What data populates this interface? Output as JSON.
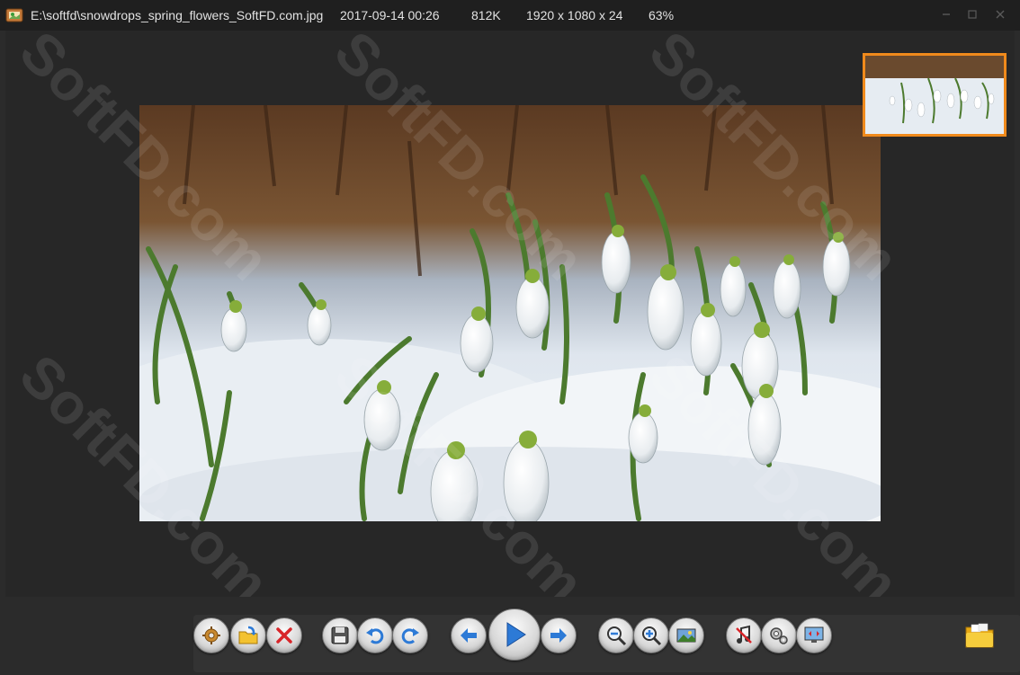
{
  "title_bar": {
    "file_path": "E:\\softfd\\snowdrops_spring_flowers_SoftFD.com.jpg",
    "date": "2017-09-14 00:26",
    "file_size": "812K",
    "dimensions": "1920 x 1080 x 24",
    "zoom": "63%",
    "controls": [
      "minimize-icon",
      "maximize-icon",
      "close-icon"
    ]
  },
  "watermark": {
    "text": "SoftFD.com"
  },
  "toolbar": {
    "buttons": [
      "settings-icon",
      "open-folder-icon",
      "delete-icon",
      "save-icon",
      "rotate-left-icon",
      "rotate-right-icon",
      "previous-icon",
      "play-slideshow-icon",
      "next-icon",
      "zoom-out-icon",
      "zoom-in-icon",
      "fit-image-icon",
      "music-icon",
      "options-icon",
      "fullscreen-icon",
      "browse-folder-icon"
    ]
  },
  "colors": {
    "background": "#2b2b2b",
    "titlebar": "#1f1f1f",
    "thumbnail_border": "#f08a1c",
    "accent_blue": "#2d7ad6"
  }
}
